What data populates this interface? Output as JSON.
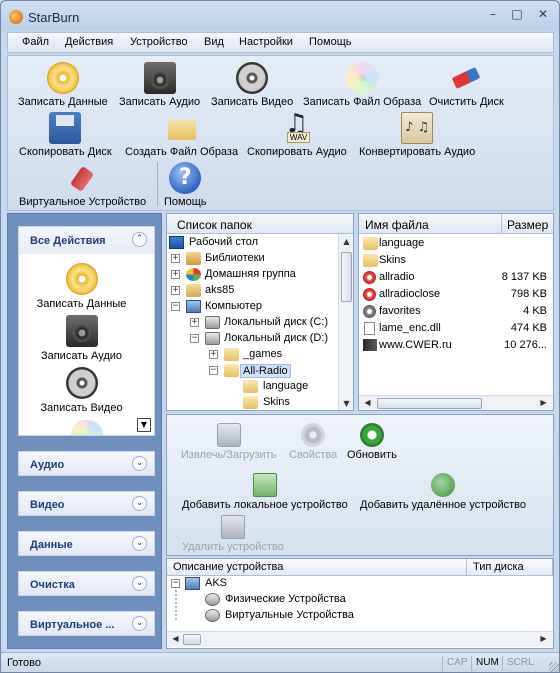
{
  "window": {
    "title": "StarBurn",
    "minimize": "–",
    "maximize": "□",
    "close": "✕"
  },
  "menu": [
    "Файл",
    "Действия",
    "Устройство",
    "Вид",
    "Настройки",
    "Помощь"
  ],
  "toolbar": {
    "burn_data": "Записать Данные",
    "burn_audio": "Записать Аудио",
    "burn_video": "Записать Видео",
    "burn_image": "Записать Файл Образа",
    "erase_disc": "Очистить Диск",
    "copy_disc": "Скопировать Диск",
    "create_image": "Создать Файл Образа",
    "copy_audio": "Скопировать Аудио",
    "convert_audio": "Конвертировать Аудио",
    "virtual_device": "Виртуальное Устройство",
    "help": "Помощь"
  },
  "tasks": {
    "open_group": "Все Действия",
    "items": [
      "Записать Данные",
      "Записать Аудио",
      "Записать Видео"
    ],
    "groups": [
      "Аудио",
      "Видео",
      "Данные",
      "Очистка",
      "Виртуальное ..."
    ]
  },
  "folder_tree": {
    "header": "Список папок",
    "nodes": [
      "Рабочий стол",
      "Библиотеки",
      "Домашняя группа",
      "aks85",
      "Компьютер",
      "Локальный диск (C:)",
      "Локальный диск (D:)",
      "_games",
      "All-Radio",
      "language",
      "Skins"
    ]
  },
  "file_list": {
    "col_name": "Имя файла",
    "col_size": "Размер",
    "rows": [
      {
        "name": "language",
        "size": ""
      },
      {
        "name": "Skins",
        "size": ""
      },
      {
        "name": "allradio",
        "size": "8 137 KB"
      },
      {
        "name": "allradioclose",
        "size": "798 KB"
      },
      {
        "name": "favorites",
        "size": "4 KB"
      },
      {
        "name": "lame_enc.dll",
        "size": "474 KB"
      },
      {
        "name": "www.CWER.ru",
        "size": "10 276..."
      }
    ]
  },
  "device_panel": {
    "eject": "Извлечь/Загрузить",
    "properties": "Свойства",
    "refresh": "Обновить",
    "add_local": "Добавить локальное устройство",
    "add_remote": "Добавить удалённое устройство",
    "remove": "Удалить устройство"
  },
  "device_tree": {
    "col_desc": "Описание устройства",
    "col_type": "Тип диска",
    "root": "AKS",
    "children": [
      "Физические Устройства",
      "Виртуальные Устройства"
    ]
  },
  "status": {
    "text": "Готово",
    "cap": "CAP",
    "num": "NUM",
    "scrl": "SCRL"
  }
}
